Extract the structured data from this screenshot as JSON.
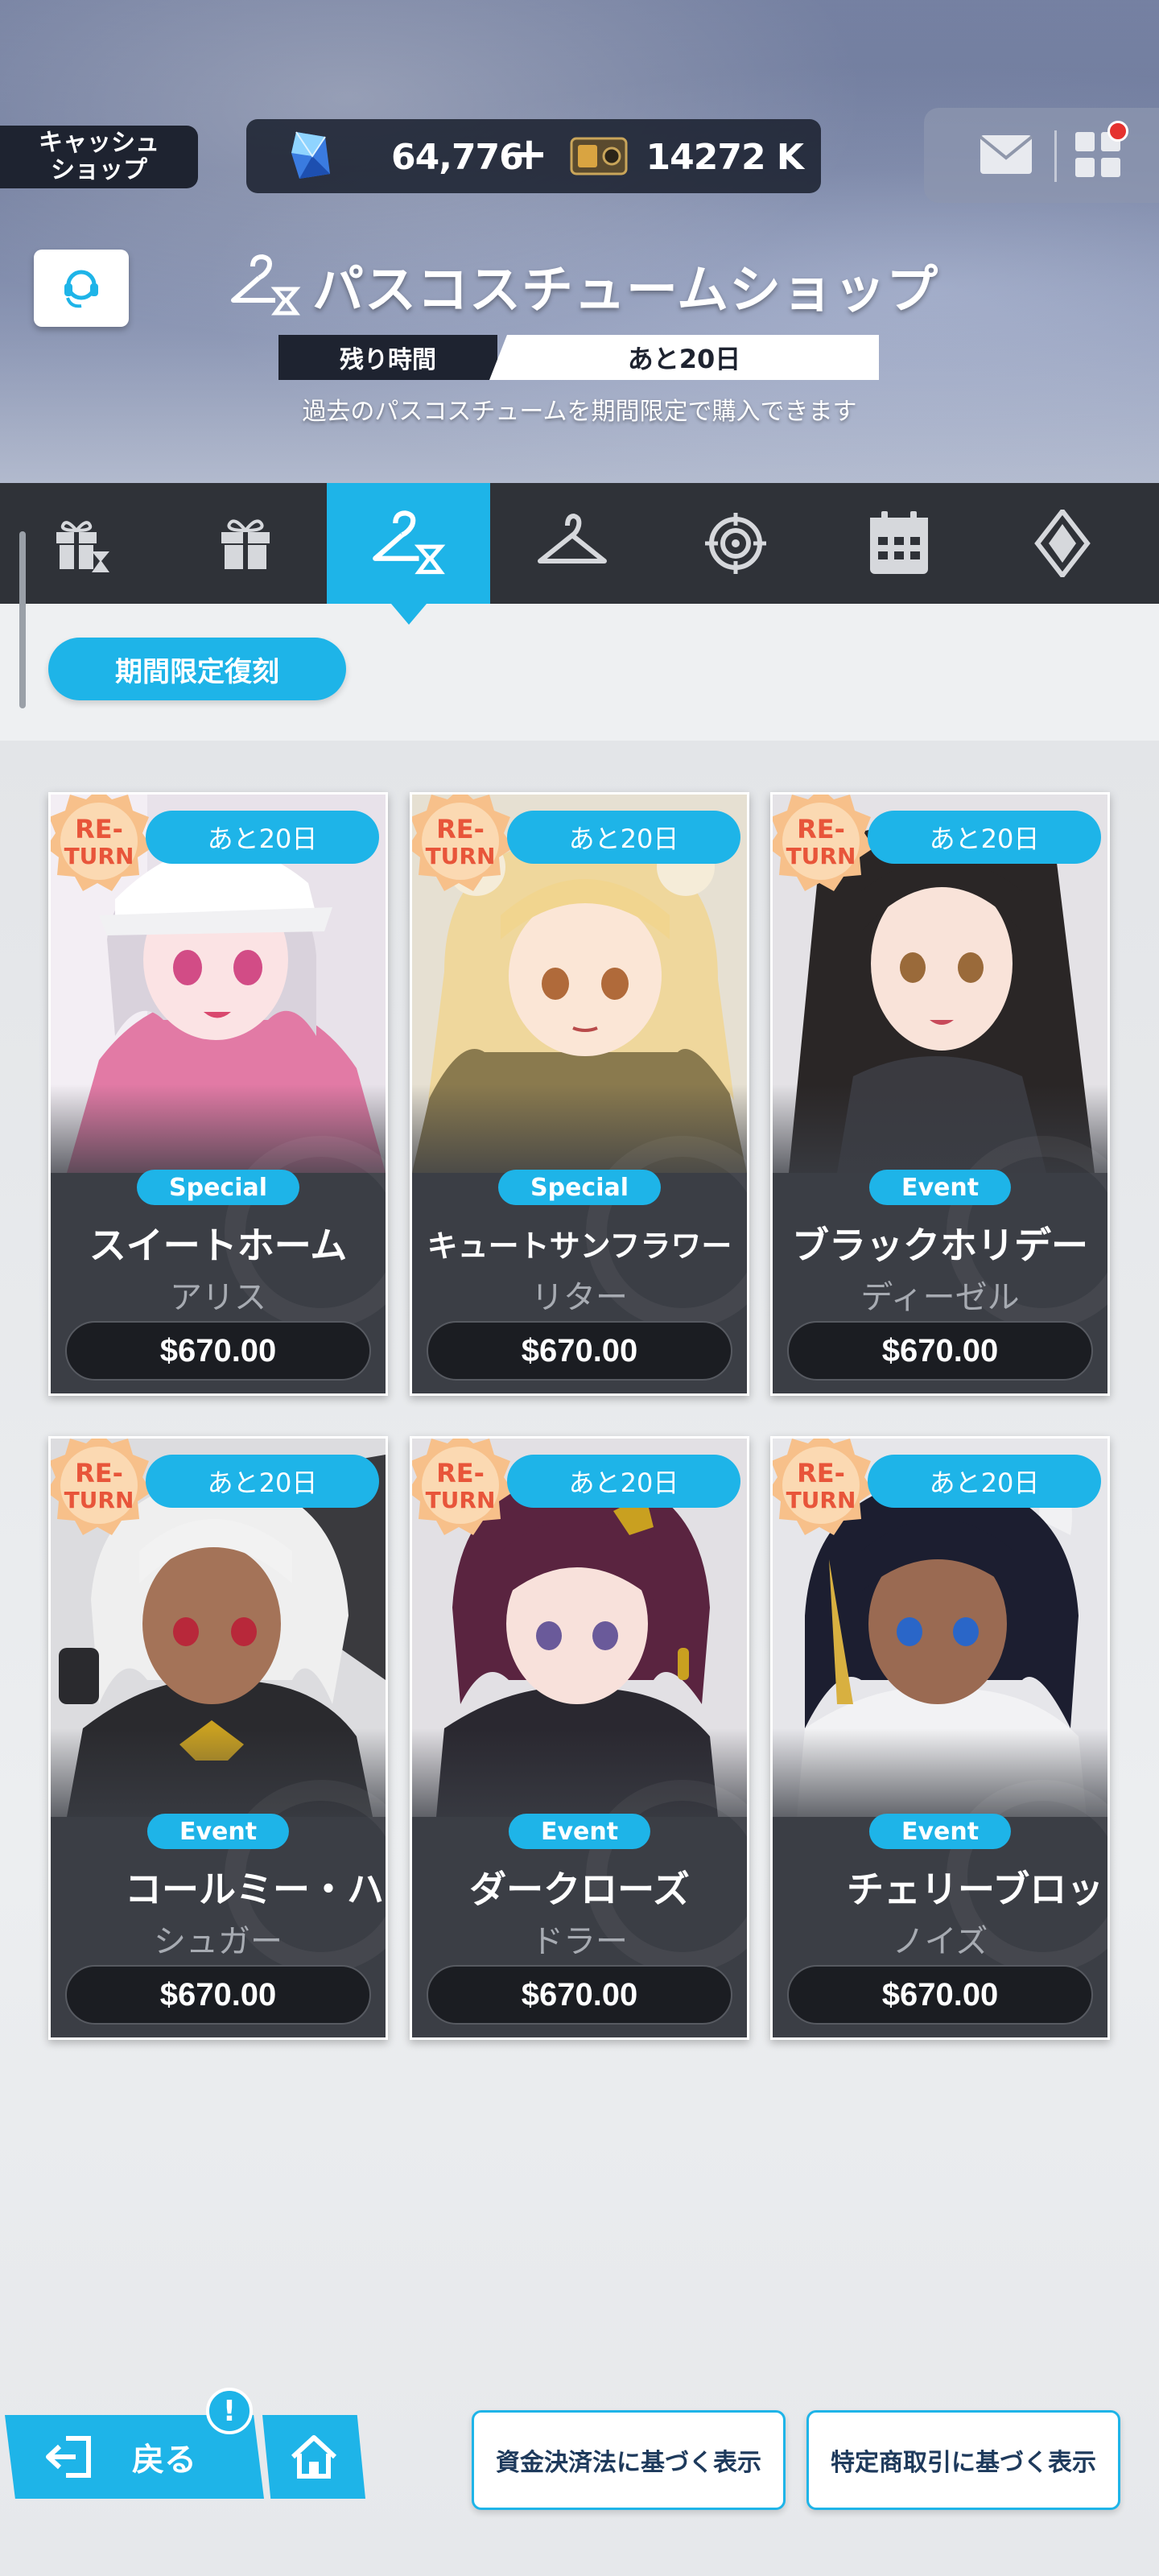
{
  "header": {
    "cash_shop_label": "キャッシュ\nショップ",
    "gems": "64,776",
    "plus": "+",
    "tickets": "14272 K",
    "has_notification": true
  },
  "shop": {
    "title": "パスコスチュームショップ",
    "remaining_label": "残り時間",
    "remaining_value": "あと20日",
    "description": "過去のパスコスチュームを期間限定で購入できます"
  },
  "tabs": [
    {
      "icon": "gift-hourglass-icon",
      "active": false
    },
    {
      "icon": "gift-icon",
      "active": false
    },
    {
      "icon": "hanger-hourglass-icon",
      "active": true
    },
    {
      "icon": "hanger-icon",
      "active": false
    },
    {
      "icon": "target-icon",
      "active": false
    },
    {
      "icon": "calendar-icon",
      "active": false
    },
    {
      "icon": "diamond-emblem-icon",
      "active": false
    }
  ],
  "filter": {
    "label": "期間限定復刻"
  },
  "cards": [
    {
      "timer": "あと20日",
      "tag": "Special",
      "name": "スイートホーム",
      "character": "アリス",
      "price": "$670.00",
      "badge": "RE-TURN"
    },
    {
      "timer": "あと20日",
      "tag": "Special",
      "name": "キュートサンフラワー",
      "character": "リター",
      "price": "$670.00",
      "badge": "RE-TURN"
    },
    {
      "timer": "あと20日",
      "tag": "Event",
      "name": "ブラックホリデー",
      "character": "ディーゼル",
      "price": "$670.00",
      "badge": "RE-TURN"
    },
    {
      "timer": "あと20日",
      "tag": "Event",
      "name": "コールミー・ハ",
      "character": "シュガー",
      "price": "$670.00",
      "badge": "RE-TURN"
    },
    {
      "timer": "あと20日",
      "tag": "Event",
      "name": "ダークローズ",
      "character": "ドラー",
      "price": "$670.00",
      "badge": "RE-TURN"
    },
    {
      "timer": "あと20日",
      "tag": "Event",
      "name": "チェリーブロッ",
      "character": "ノイズ",
      "price": "$670.00",
      "badge": "RE-TURN"
    }
  ],
  "bottom": {
    "back_label": "戻る",
    "notice_badge": "!",
    "legal_funds": "資金決済法に基づく表示",
    "legal_commerce": "特定商取引に基づく表示"
  },
  "colors": {
    "accent": "#1eb4e8",
    "dark": "#1e2330",
    "card_bg": "#3b3e45",
    "badge_orange": "#f07a3a"
  }
}
